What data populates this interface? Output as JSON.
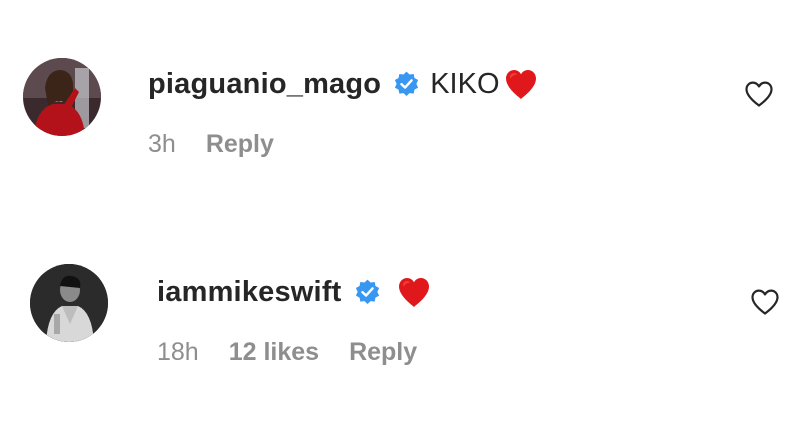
{
  "comments": [
    {
      "username": "piaguanio_mago",
      "verified": true,
      "text": "KIKO",
      "emoji": "red-heart",
      "time": "3h",
      "likes": "",
      "reply_label": "Reply",
      "like_icon": "heart-outline-icon"
    },
    {
      "username": "iammikeswift",
      "verified": true,
      "text": "",
      "emoji": "red-heart",
      "time": "18h",
      "likes": "12 likes",
      "reply_label": "Reply",
      "like_icon": "heart-outline-icon"
    }
  ],
  "colors": {
    "username": "#262626",
    "meta": "#8e8e8e",
    "verified_badge": "#3897f0",
    "heart_emoji": "#e0181b"
  }
}
